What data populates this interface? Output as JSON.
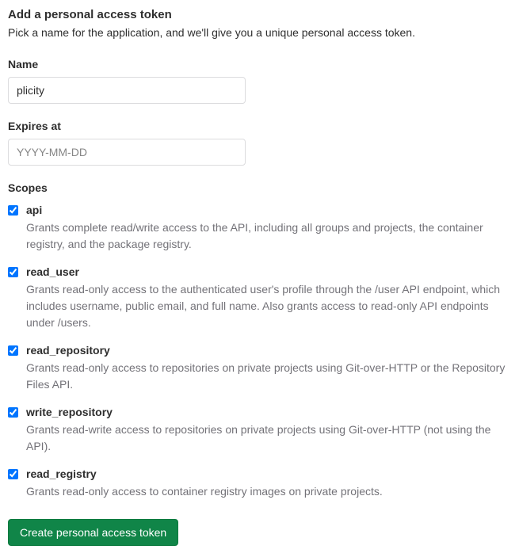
{
  "heading": "Add a personal access token",
  "subheading": "Pick a name for the application, and we'll give you a unique personal access token.",
  "name_field": {
    "label": "Name",
    "value": "plicity"
  },
  "expires_field": {
    "label": "Expires at",
    "placeholder": "YYYY-MM-DD",
    "value": ""
  },
  "scopes_label": "Scopes",
  "scopes": [
    {
      "key": "api",
      "name": "api",
      "description": "Grants complete read/write access to the API, including all groups and projects, the container registry, and the package registry.",
      "checked": true
    },
    {
      "key": "read_user",
      "name": "read_user",
      "description": "Grants read-only access to the authenticated user's profile through the /user API endpoint, which includes username, public email, and full name. Also grants access to read-only API endpoints under /users.",
      "checked": true
    },
    {
      "key": "read_repository",
      "name": "read_repository",
      "description": "Grants read-only access to repositories on private projects using Git-over-HTTP or the Repository Files API.",
      "checked": true
    },
    {
      "key": "write_repository",
      "name": "write_repository",
      "description": "Grants read-write access to repositories on private projects using Git-over-HTTP (not using the API).",
      "checked": true
    },
    {
      "key": "read_registry",
      "name": "read_registry",
      "description": "Grants read-only access to container registry images on private projects.",
      "checked": true
    }
  ],
  "submit_label": "Create personal access token"
}
